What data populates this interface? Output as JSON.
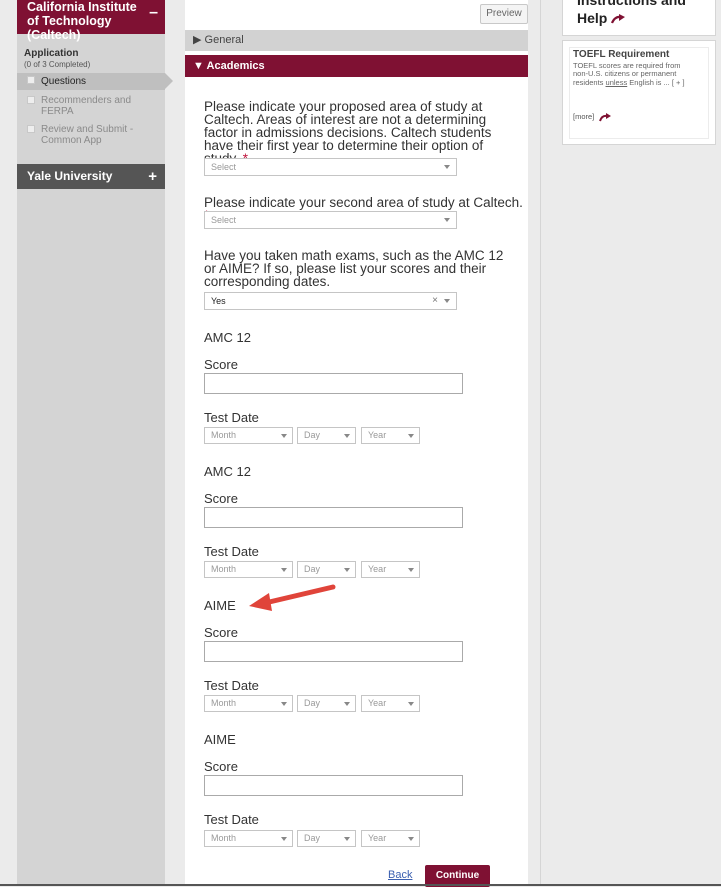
{
  "sidebar": {
    "school_title": "California Institute of Technology (Caltech)",
    "collapse_symbol": "–",
    "application_title": "Application",
    "application_progress": "(0 of 3 Completed)",
    "items": [
      {
        "label": "Questions"
      },
      {
        "label": "Recommenders and FERPA"
      },
      {
        "label": "Review and Submit - Common App"
      }
    ],
    "second_school_title": "Yale University",
    "expand_symbol": "+"
  },
  "main": {
    "preview_label": "Preview",
    "section_general": "General",
    "section_academics": "Academics",
    "q1_text": "Please indicate your proposed area of study at Caltech. Areas of interest are not a determining factor in admissions decisions. Caltech students have their first year to determine their option of study.",
    "q1_select": "Select",
    "q2_text": "Please indicate your second area of study at Caltech.",
    "q2_select": "Select",
    "q3_text": "Have you taken math exams, such as the AMC 12 or AIME? If so, please list your scores and their corresponding dates.",
    "q3_value": "Yes",
    "q3_clear": "×",
    "required_mark": "*",
    "exams": [
      {
        "name": "AMC 12",
        "score_label": "Score",
        "date_label": "Test Date",
        "month": "Month",
        "day": "Day",
        "year": "Year"
      },
      {
        "name": "AMC 12",
        "score_label": "Score",
        "date_label": "Test Date",
        "month": "Month",
        "day": "Day",
        "year": "Year"
      },
      {
        "name": "AIME",
        "score_label": "Score",
        "date_label": "Test Date",
        "month": "Month",
        "day": "Day",
        "year": "Year"
      },
      {
        "name": "AIME",
        "score_label": "Score",
        "date_label": "Test Date",
        "month": "Month",
        "day": "Day",
        "year": "Year"
      }
    ],
    "back_label": "Back",
    "continue_label": "Continue"
  },
  "right": {
    "header_title": "Instructions and Help",
    "toefl_title": "TOEFL Requirement",
    "toefl_body_pre": "TOEFL scores are required from non-U.S. citizens or permanent residents ",
    "toefl_body_underline": "unless",
    "toefl_body_post": " English is ... [ + ]",
    "more_label": "[more]"
  },
  "colors": {
    "brand": "#7f1133",
    "annotation_arrow": "#e0443a"
  }
}
